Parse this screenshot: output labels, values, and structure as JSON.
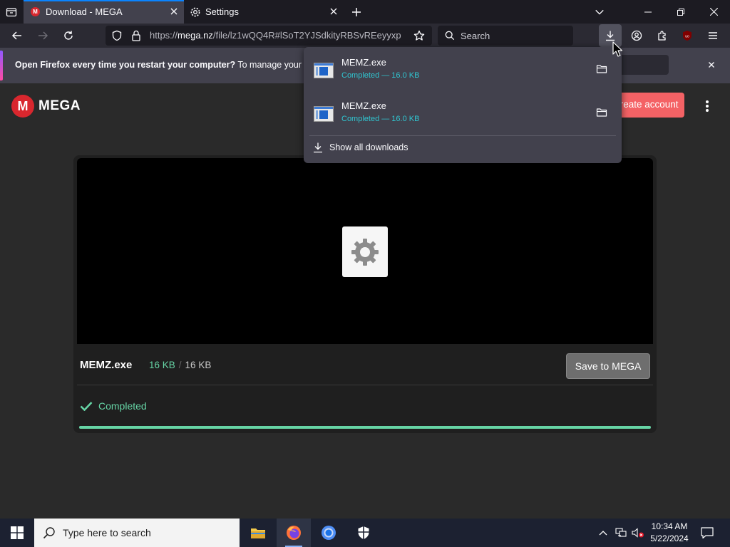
{
  "browser": {
    "tabs": [
      {
        "label": "Download - MEGA",
        "active": true,
        "icon": "mega-favicon"
      },
      {
        "label": "Settings",
        "active": false,
        "icon": "gear-icon"
      }
    ],
    "url": {
      "prefix": "https://",
      "host": "mega.nz",
      "path": "/file/lz1wQQ4R#lSoT2YJSdkityRBSvREeyyxp"
    },
    "search_placeholder": "Search"
  },
  "notification": {
    "bold": "Open Firefox every time you restart your computer?",
    "text": " To manage your Start"
  },
  "downloads_panel": {
    "items": [
      {
        "name": "MEMZ.exe",
        "status": "Completed — 16.0 KB"
      },
      {
        "name": "MEMZ.exe",
        "status": "Completed — 16.0 KB"
      }
    ],
    "show_all": "Show all downloads"
  },
  "mega": {
    "logo": "MEGA",
    "create_account": "Create account",
    "file_name": "MEMZ.exe",
    "size_done": "16 KB",
    "size_sep": "/",
    "size_total": "16 KB",
    "save_button": "Save to MEGA",
    "status": "Completed",
    "progress_percent": 100
  },
  "taskbar": {
    "search_placeholder": "Type here to search",
    "time": "10:34 AM",
    "date": "5/22/2024"
  },
  "colors": {
    "accent_green": "#66d4a5",
    "mega_red": "#d9272e",
    "firefox_blue": "#0a84ff",
    "download_status": "#30c5d0"
  }
}
